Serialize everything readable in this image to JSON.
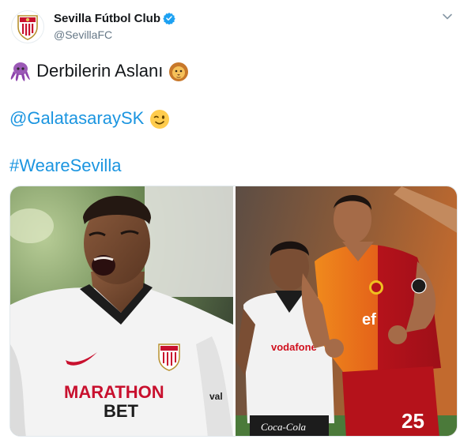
{
  "author": {
    "display_name": "Sevilla Fútbol Club",
    "handle": "@SevillaFC",
    "verified": true
  },
  "tweet": {
    "line1_text": "Derbilerin Aslanı",
    "line1_emoji_left": "octopus-emoji",
    "line1_emoji_right": "lion-emoji",
    "mention": "@GalatasaraySK",
    "mention_emoji": "winking-face-emoji",
    "hashtag": "#WeareSevilla"
  },
  "media": {
    "photo_left": {
      "shirt_sponsor": "MARATHON",
      "shirt_sponsor_2": "BET",
      "sleeve_text": "val",
      "shirt_color": "#f4f4f4",
      "trim_color": "#c8102e"
    },
    "photo_right": {
      "front_player_number": "25",
      "front_player_shirt_colors": [
        "#e8661a",
        "#b5121b"
      ],
      "rear_player_shirt_color": "#f2f2f2",
      "rear_player_sponsor": "vodafone",
      "rear_player_shorts_sponsor": "Coca-Cola",
      "front_player_sponsor": "ef"
    }
  },
  "colors": {
    "link": "#1b95e0",
    "verified": "#1da1f2",
    "text": "#14171a",
    "muted": "#657786"
  }
}
